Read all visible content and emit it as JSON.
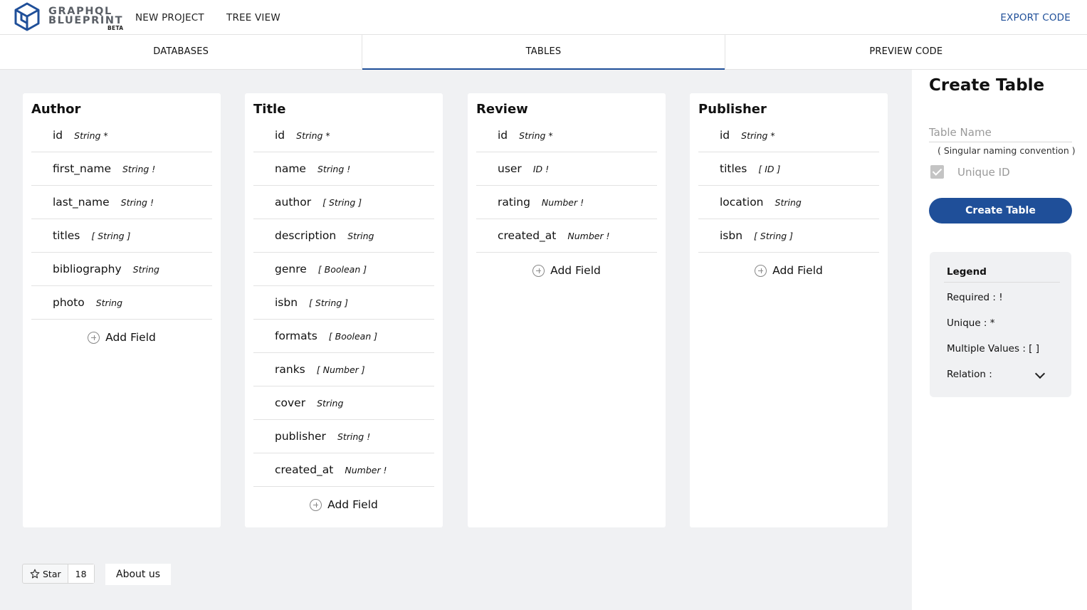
{
  "header": {
    "logo_line1": "GRAPHQL",
    "logo_line2": "BLUEPRINT",
    "logo_beta": "BETA",
    "nav": [
      "NEW PROJECT",
      "TREE VIEW"
    ],
    "export": "EXPORT CODE"
  },
  "tabs": [
    "DATABASES",
    "TABLES",
    "PREVIEW CODE"
  ],
  "active_tab": "TABLES",
  "accent_color": "#1f4f99",
  "tables": [
    {
      "title": "Author",
      "fields": [
        {
          "name": "id",
          "type": "String *"
        },
        {
          "name": "first_name",
          "type": "String !"
        },
        {
          "name": "last_name",
          "type": "String !"
        },
        {
          "name": "titles",
          "type": "[ String ]"
        },
        {
          "name": "bibliography",
          "type": "String"
        },
        {
          "name": "photo",
          "type": "String"
        }
      ]
    },
    {
      "title": "Title",
      "fields": [
        {
          "name": "id",
          "type": "String *"
        },
        {
          "name": "name",
          "type": "String !"
        },
        {
          "name": "author",
          "type": "[ String ]"
        },
        {
          "name": "description",
          "type": "String"
        },
        {
          "name": "genre",
          "type": "[ Boolean ]"
        },
        {
          "name": "isbn",
          "type": "[ String ]"
        },
        {
          "name": "formats",
          "type": "[ Boolean ]"
        },
        {
          "name": "ranks",
          "type": "[ Number ]"
        },
        {
          "name": "cover",
          "type": "String"
        },
        {
          "name": "publisher",
          "type": "String !"
        },
        {
          "name": "created_at",
          "type": "Number !"
        }
      ]
    },
    {
      "title": "Review",
      "fields": [
        {
          "name": "id",
          "type": "String *"
        },
        {
          "name": "user",
          "type": "ID !"
        },
        {
          "name": "rating",
          "type": "Number !"
        },
        {
          "name": "created_at",
          "type": "Number !"
        }
      ]
    },
    {
      "title": "Publisher",
      "fields": [
        {
          "name": "id",
          "type": "String *"
        },
        {
          "name": "titles",
          "type": "[ ID ]"
        },
        {
          "name": "location",
          "type": "String"
        },
        {
          "name": "isbn",
          "type": "[ String ]"
        }
      ]
    }
  ],
  "add_field_label": "Add Field",
  "footer": {
    "star_label": "Star",
    "star_count": "18",
    "about": "About us"
  },
  "create_panel": {
    "title": "Create Table",
    "table_name_placeholder": "Table Name",
    "naming_hint": "( Singular naming convention )",
    "unique_id_label": "Unique ID",
    "unique_id_checked": true,
    "button": "Create Table"
  },
  "legend": {
    "title": "Legend",
    "items": [
      "Required : !",
      "Unique : *",
      "Multiple Values : [ ]",
      "Relation :"
    ]
  }
}
